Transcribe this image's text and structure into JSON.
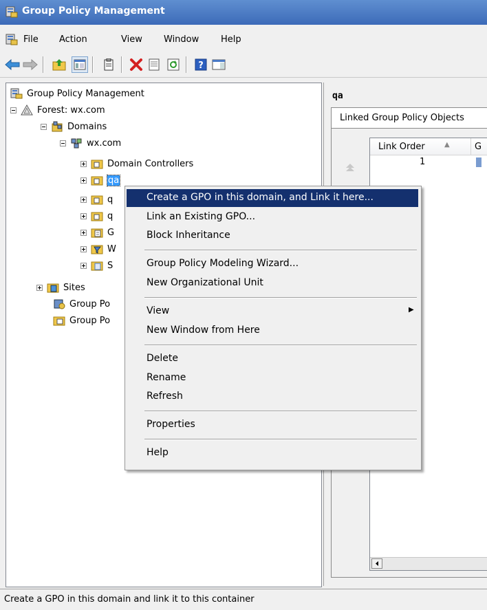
{
  "window": {
    "title": "Group Policy Management"
  },
  "menubar": {
    "items": [
      "File",
      "Action",
      "View",
      "Window",
      "Help"
    ]
  },
  "toolbar": {
    "icons": [
      "back-arrow-icon",
      "forward-arrow-icon",
      "up-folder-icon",
      "show-hide-tree-icon",
      "copy-icon",
      "delete-icon",
      "properties-icon",
      "refresh-icon",
      "help-icon",
      "show-action-pane-icon"
    ]
  },
  "tree": {
    "root": "Group Policy Management",
    "forest": "Forest: wx.com",
    "domains": "Domains",
    "domain": "wx.com",
    "children": [
      "Domain Controllers",
      "qa",
      "q",
      "q",
      "G",
      "W",
      "S"
    ],
    "sites": "Sites",
    "modeling": "Group Po",
    "results": "Group Po"
  },
  "right_pane": {
    "heading": "qa",
    "tab": "Linked Group Policy Objects",
    "column_header": "Link Order",
    "column_header_2": "G",
    "rows": [
      {
        "link_order": "1"
      }
    ]
  },
  "context_menu": {
    "items": [
      "Create a GPO in this domain, and Link it here...",
      "Link an Existing GPO...",
      "Block Inheritance",
      "Group Policy Modeling Wizard...",
      "New Organizational Unit",
      "View",
      "New Window from Here",
      "Delete",
      "Rename",
      "Refresh",
      "Properties",
      "Help"
    ],
    "highlighted_index": 0,
    "highlight_color": "#14306e"
  },
  "statusbar": {
    "text": "Create a GPO in this domain and link it to this container"
  },
  "colors": {
    "titlebar": "#3c6ab8",
    "selection": "#3399ff"
  }
}
